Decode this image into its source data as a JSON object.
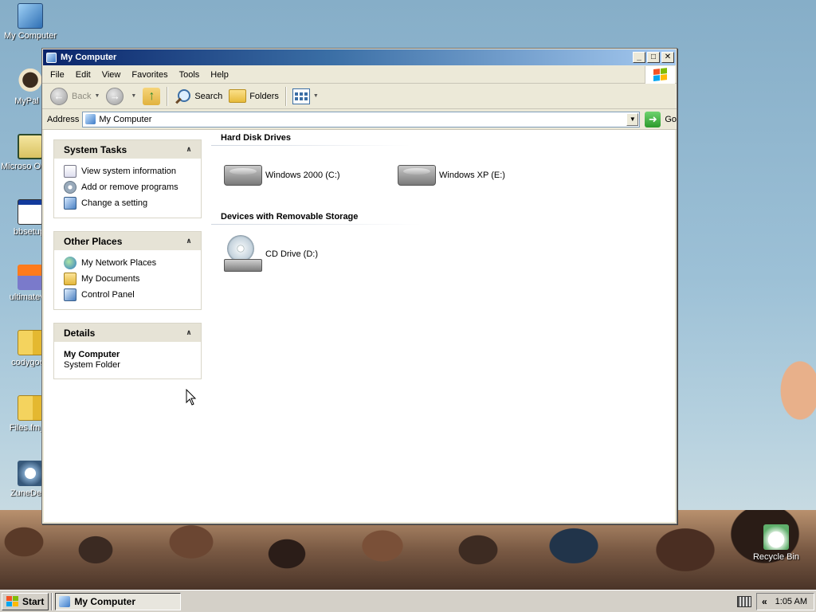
{
  "desktop": {
    "icons": [
      {
        "label": "My Computer",
        "icon": "my-computer-icon"
      },
      {
        "label": "MyPal a",
        "icon": "dog-shortcut-icon"
      },
      {
        "label": "Microso Outloo",
        "icon": "outlook-icon"
      },
      {
        "label": "bbsetup.",
        "icon": "setup-window-icon"
      },
      {
        "label": "ultimatevid",
        "icon": "installer-icon"
      },
      {
        "label": "codygoon",
        "icon": "zip-folder-icon"
      },
      {
        "label": "Files.fm_D",
        "icon": "zip-folder-icon"
      },
      {
        "label": "ZuneDesk",
        "icon": "zune-icon"
      },
      {
        "label": "Recycle Bin",
        "icon": "recycle-bin-icon"
      }
    ]
  },
  "window": {
    "title": "My Computer",
    "controls": {
      "minimize": "_",
      "maximize": "□",
      "close": "✕"
    },
    "menu": [
      "File",
      "Edit",
      "View",
      "Favorites",
      "Tools",
      "Help"
    ],
    "toolbar": {
      "back": "Back",
      "search": "Search",
      "folders": "Folders"
    },
    "address": {
      "label": "Address",
      "value": "My Computer",
      "go": "Go"
    },
    "taskpane": {
      "system_tasks": {
        "title": "System Tasks",
        "items": [
          "View system information",
          "Add or remove programs",
          "Change a setting"
        ]
      },
      "other_places": {
        "title": "Other Places",
        "items": [
          "My Network Places",
          "My Documents",
          "Control Panel"
        ]
      },
      "details": {
        "title": "Details",
        "name": "My Computer",
        "type": "System Folder"
      }
    },
    "sections": {
      "hard_disks": {
        "title": "Hard Disk Drives",
        "drives": [
          "Windows 2000 (C:)",
          "Windows XP (E:)"
        ]
      },
      "removable": {
        "title": "Devices with Removable Storage",
        "drives": [
          "CD Drive (D:)"
        ]
      }
    }
  },
  "taskbar": {
    "start": "Start",
    "task": "My Computer",
    "chevron": "«",
    "clock": "1:05 AM"
  }
}
